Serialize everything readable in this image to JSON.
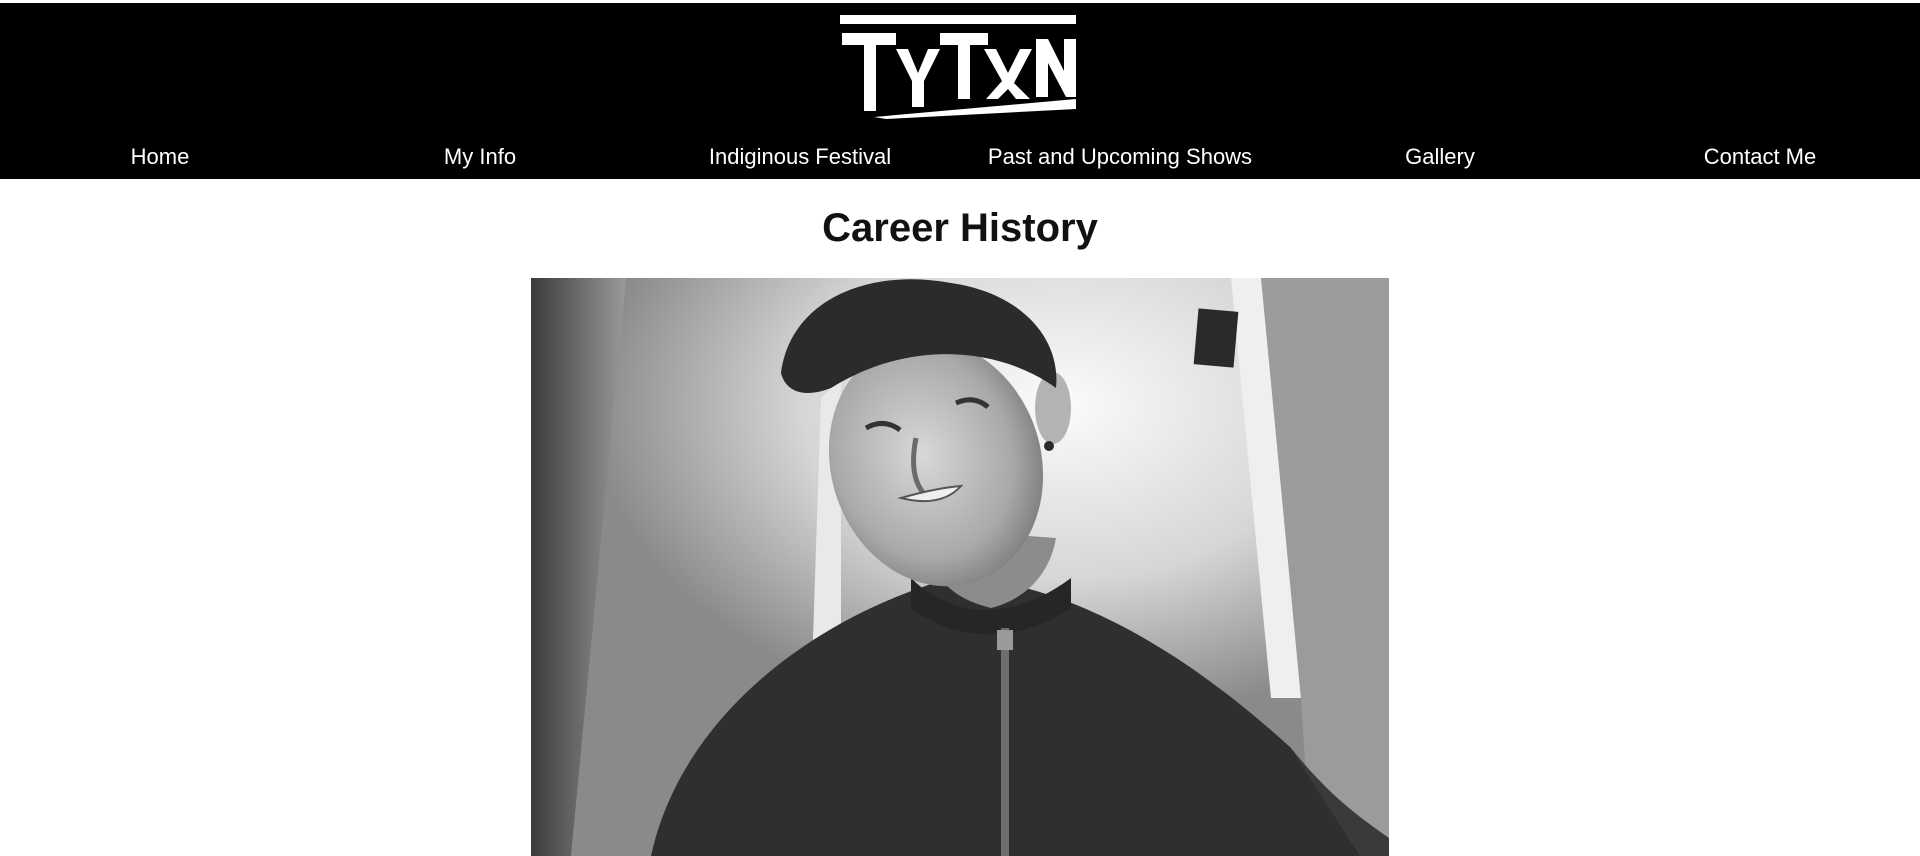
{
  "header": {
    "logo_text": "TYTAN",
    "background": "#000000",
    "text_color": "#ffffff"
  },
  "nav": {
    "items": [
      {
        "label": "Home"
      },
      {
        "label": "My Info"
      },
      {
        "label": "Indiginous Festival"
      },
      {
        "label": "Past and Upcoming Shows"
      },
      {
        "label": "Gallery"
      },
      {
        "label": "Contact Me"
      }
    ]
  },
  "main": {
    "title": "Career History",
    "photo": {
      "style": "black-and-white portrait"
    }
  }
}
